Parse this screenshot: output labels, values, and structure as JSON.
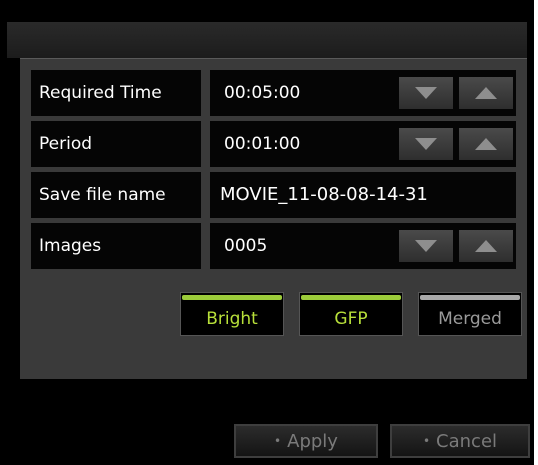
{
  "settings": {
    "required_time": {
      "label": "Required Time",
      "value": "00:05:00"
    },
    "period": {
      "label": "Period",
      "value": "00:01:00"
    },
    "save_file_name": {
      "label": "Save file name",
      "value": "MOVIE_11-08-08-14-31"
    },
    "images": {
      "label": "Images",
      "value": "0005"
    }
  },
  "channels": [
    {
      "label": "Bright",
      "state": "on",
      "color": "#9ccc3a"
    },
    {
      "label": "GFP",
      "state": "on",
      "color": "#9ccc3a"
    },
    {
      "label": "Merged",
      "state": "off",
      "color": "#a8a8a8"
    }
  ],
  "footer": {
    "apply": {
      "bullet": "•",
      "label": "Apply"
    },
    "cancel": {
      "bullet": "•",
      "label": "Cancel"
    }
  },
  "icons": {
    "decrement": "triangle-down-icon",
    "increment": "triangle-up-icon"
  }
}
